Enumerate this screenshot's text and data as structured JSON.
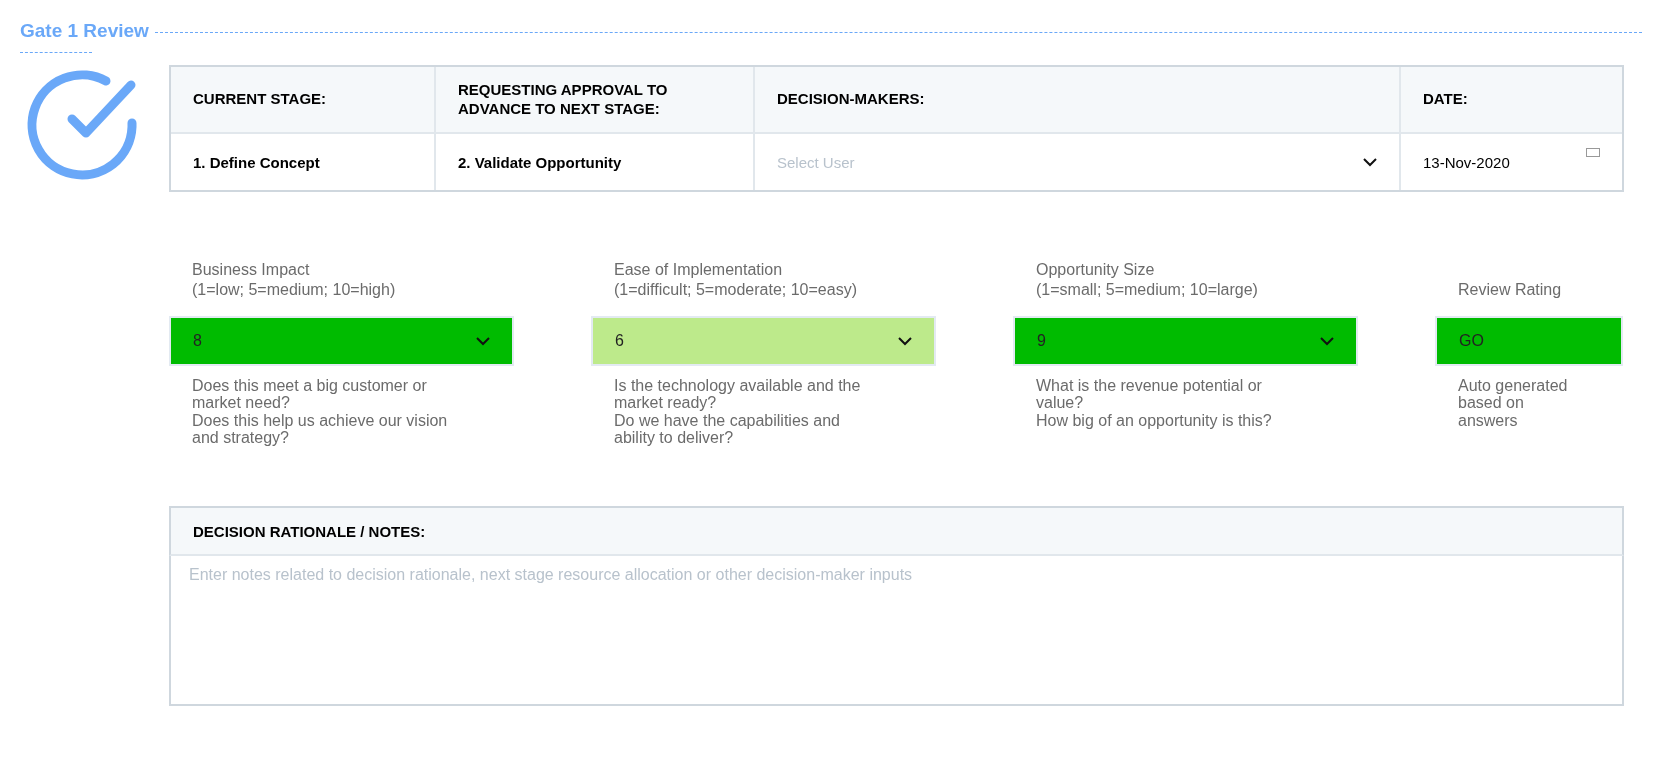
{
  "title": "Gate 1 Review",
  "stage_table": {
    "columns": [
      "CURRENT STAGE:",
      "REQUESTING APPROVAL TO ADVANCE TO NEXT STAGE:",
      "DECISION-MAKERS:",
      "DATE:"
    ],
    "current_stage": "1. Define Concept",
    "next_stage": "2. Validate Opportunity",
    "decision_makers": {
      "placeholder": "Select User"
    },
    "date": "13-Nov-2020"
  },
  "scores": [
    {
      "kind": "select",
      "label": "Business Impact",
      "scale": "(1=low; 5=medium; 10=high)",
      "value": "8",
      "color": "#00bb00",
      "help": [
        "Does this meet a big customer or market need?",
        "Does this help us achieve our vision and strategy?"
      ]
    },
    {
      "kind": "select",
      "label": "Ease of Implementation",
      "scale": "(1=difficult; 5=moderate; 10=easy)",
      "value": "6",
      "color": "#bdea8b",
      "help": [
        "Is the technology available and the market ready?",
        "Do we have the capabilities and ability to deliver?"
      ]
    },
    {
      "kind": "select",
      "label": "Opportunity Size",
      "scale": "(1=small; 5=medium; 10=large)",
      "value": "9",
      "color": "#00bb00",
      "help": [
        "What is the revenue potential or value?",
        "How big of an opportunity is this?"
      ]
    },
    {
      "kind": "readout",
      "label": "Review Rating",
      "value": "GO",
      "color": "#00bb00",
      "help": [
        "Auto generated based on answers"
      ]
    }
  ],
  "notes": {
    "heading": "DECISION RATIONALE / NOTES:",
    "placeholder": "Enter notes related to decision rationale, next stage resource allocation or other decision-maker inputs"
  }
}
